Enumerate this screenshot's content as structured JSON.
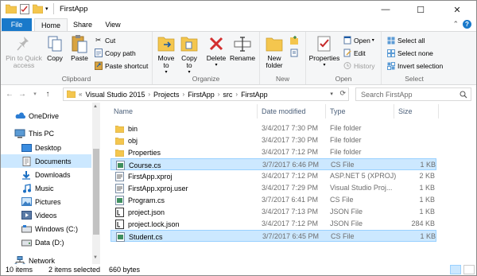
{
  "window": {
    "title": "FirstApp",
    "minimize": "—",
    "maximize": "☐",
    "close": "✕"
  },
  "tabs": {
    "file": "File",
    "home": "Home",
    "share": "Share",
    "view": "View"
  },
  "ribbon": {
    "clipboard": {
      "label": "Clipboard",
      "pin": "Pin to Quick access",
      "copy": "Copy",
      "paste": "Paste",
      "cut": "Cut",
      "copy_path": "Copy path",
      "paste_shortcut": "Paste shortcut"
    },
    "organize": {
      "label": "Organize",
      "move_to": "Move to",
      "copy_to": "Copy to",
      "delete": "Delete",
      "rename": "Rename"
    },
    "new": {
      "label": "New",
      "new_folder": "New folder"
    },
    "open": {
      "label": "Open",
      "properties": "Properties",
      "open": "Open",
      "edit": "Edit",
      "history": "History"
    },
    "select": {
      "label": "Select",
      "select_all": "Select all",
      "select_none": "Select none",
      "invert_selection": "Invert selection"
    }
  },
  "address": {
    "crumbs": [
      "Visual Studio 2015",
      "Projects",
      "FirstApp",
      "src",
      "FirstApp"
    ],
    "search_placeholder": "Search FirstApp"
  },
  "nav": {
    "items": [
      {
        "label": "OneDrive",
        "icon": "cloud-icon"
      },
      {
        "label": "This PC",
        "icon": "computer-icon"
      },
      {
        "label": "Desktop",
        "icon": "desktop-icon"
      },
      {
        "label": "Documents",
        "icon": "documents-icon"
      },
      {
        "label": "Downloads",
        "icon": "downloads-icon"
      },
      {
        "label": "Music",
        "icon": "music-icon"
      },
      {
        "label": "Pictures",
        "icon": "pictures-icon"
      },
      {
        "label": "Videos",
        "icon": "videos-icon"
      },
      {
        "label": "Windows (C:)",
        "icon": "drive-icon"
      },
      {
        "label": "Data (D:)",
        "icon": "drive-icon"
      },
      {
        "label": "Network",
        "icon": "network-icon"
      }
    ]
  },
  "columns": {
    "name": "Name",
    "date": "Date modified",
    "type": "Type",
    "size": "Size"
  },
  "files": [
    {
      "name": "bin",
      "date": "3/4/2017 7:30 PM",
      "type": "File folder",
      "size": "",
      "icon": "folder-icon"
    },
    {
      "name": "obj",
      "date": "3/4/2017 7:30 PM",
      "type": "File folder",
      "size": "",
      "icon": "folder-icon"
    },
    {
      "name": "Properties",
      "date": "3/4/2017 7:12 PM",
      "type": "File folder",
      "size": "",
      "icon": "folder-icon"
    },
    {
      "name": "Course.cs",
      "date": "3/7/2017 6:46 PM",
      "type": "CS File",
      "size": "1 KB",
      "icon": "cs-file-icon",
      "selected": true
    },
    {
      "name": "FirstApp.xproj",
      "date": "3/4/2017 7:12 PM",
      "type": "ASP.NET 5 (XPROJ)",
      "size": "2 KB",
      "icon": "xproj-file-icon"
    },
    {
      "name": "FirstApp.xproj.user",
      "date": "3/4/2017 7:29 PM",
      "type": "Visual Studio Proj...",
      "size": "1 KB",
      "icon": "vs-user-file-icon"
    },
    {
      "name": "Program.cs",
      "date": "3/7/2017 6:41 PM",
      "type": "CS File",
      "size": "1 KB",
      "icon": "cs-file-icon"
    },
    {
      "name": "project.json",
      "date": "3/4/2017 7:13 PM",
      "type": "JSON File",
      "size": "1 KB",
      "icon": "json-file-icon"
    },
    {
      "name": "project.lock.json",
      "date": "3/4/2017 7:12 PM",
      "type": "JSON File",
      "size": "284 KB",
      "icon": "json-file-icon"
    },
    {
      "name": "Student.cs",
      "date": "3/7/2017 6:45 PM",
      "type": "CS File",
      "size": "1 KB",
      "icon": "cs-file-icon",
      "selected": true
    }
  ],
  "status": {
    "items": "10 items",
    "selected": "2 items selected",
    "size": "660 bytes"
  },
  "colors": {
    "accent": "#1979ca",
    "selection": "#cce8ff",
    "folder": "#f4c64e"
  }
}
